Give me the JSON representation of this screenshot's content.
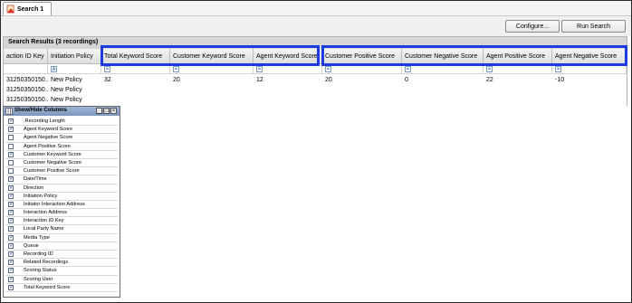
{
  "tab": {
    "label": "Search 1"
  },
  "toolbar": {
    "configure_label": "Configure...",
    "run_label": "Run Search"
  },
  "results": {
    "title": "Search Results (3 recordings)"
  },
  "grid": {
    "columns": [
      "action ID Key",
      "Initiation Policy",
      "Total Keyword Score",
      "Customer Keyword Score",
      "Agent Keyword Score",
      "Customer Positive Score",
      "Customer Negative Score",
      "Agent Positive Score",
      "Agent Negative Score"
    ],
    "filter_icons": [
      "A",
      "A",
      "=",
      "=",
      "=",
      "=",
      "=",
      "=",
      "="
    ],
    "rows": [
      [
        "31250350150...",
        "New Policy",
        "32",
        "20",
        "12",
        "20",
        "0",
        "22",
        "-10"
      ],
      [
        "31250350150...",
        "New Policy",
        "",
        "",
        "",
        "",
        "",
        "",
        ""
      ],
      [
        "31250350150...",
        "New Policy",
        "",
        "",
        "",
        "",
        "",
        "",
        ""
      ]
    ]
  },
  "panel": {
    "title": "Show/Hide Columns",
    "items": [
      {
        "label": ".Recording Length",
        "checked": true
      },
      {
        "label": "Agent Keyword Score",
        "checked": true
      },
      {
        "label": "Agent Negative Score",
        "checked": false
      },
      {
        "label": "Agent Positive Score",
        "checked": false
      },
      {
        "label": "Customer Keyword Score",
        "checked": true
      },
      {
        "label": "Customer Negative Score",
        "checked": false
      },
      {
        "label": "Customer Positive Score",
        "checked": false
      },
      {
        "label": "Date/Time",
        "checked": true
      },
      {
        "label": "Direction",
        "checked": true
      },
      {
        "label": "Initiation Policy",
        "checked": true
      },
      {
        "label": "Initiator Interaction Address",
        "checked": true
      },
      {
        "label": "Interaction Address",
        "checked": true
      },
      {
        "label": "Interaction ID Key",
        "checked": true
      },
      {
        "label": "Local Party Name",
        "checked": true
      },
      {
        "label": "Media Type",
        "checked": true
      },
      {
        "label": "Queue",
        "checked": true
      },
      {
        "label": "Recording ID",
        "checked": true
      },
      {
        "label": "Related Recordings",
        "checked": true
      },
      {
        "label": "Scoring Status",
        "checked": true
      },
      {
        "label": "Scoring User",
        "checked": true
      },
      {
        "label": "Total Keyword Score",
        "checked": true
      }
    ]
  },
  "colors": {
    "highlight": "#1d3ce0",
    "panel_title": "#8aa2c8"
  }
}
